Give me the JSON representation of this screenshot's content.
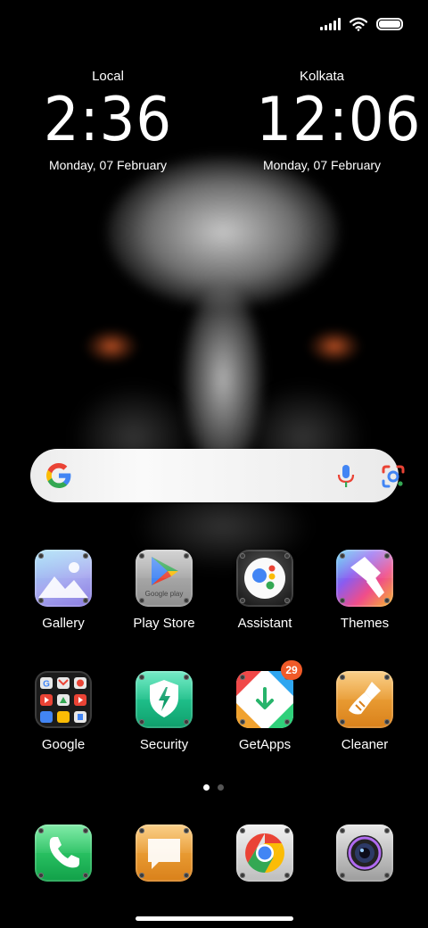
{
  "status_bar": {
    "icons": [
      "signal-icon",
      "wifi-icon",
      "battery-icon"
    ]
  },
  "clocks": [
    {
      "city": "Local",
      "time": "2:36",
      "date": "Monday, 07 February"
    },
    {
      "city": "Kolkata",
      "time": "12:06",
      "date": "Monday, 07 February"
    }
  ],
  "search": {
    "icons": [
      "google-logo",
      "mic-icon",
      "lens-icon"
    ]
  },
  "apps": [
    {
      "label": "Gallery",
      "icon": "gallery-icon"
    },
    {
      "label": "Play Store",
      "icon": "play-store-icon"
    },
    {
      "label": "Assistant",
      "icon": "assistant-icon"
    },
    {
      "label": "Themes",
      "icon": "themes-icon"
    },
    {
      "label": "Google",
      "icon": "google-folder-icon"
    },
    {
      "label": "Security",
      "icon": "security-icon"
    },
    {
      "label": "GetApps",
      "icon": "getapps-icon",
      "badge": "29"
    },
    {
      "label": "Cleaner",
      "icon": "cleaner-icon"
    }
  ],
  "dock": [
    {
      "icon": "phone-icon"
    },
    {
      "icon": "messages-icon"
    },
    {
      "icon": "chrome-icon"
    },
    {
      "icon": "camera-icon"
    }
  ],
  "play_store_icon_text": "Google play",
  "pages": {
    "count": 2,
    "current": 1
  },
  "colors": {
    "badge": "#f05a28",
    "background": "#000000"
  }
}
